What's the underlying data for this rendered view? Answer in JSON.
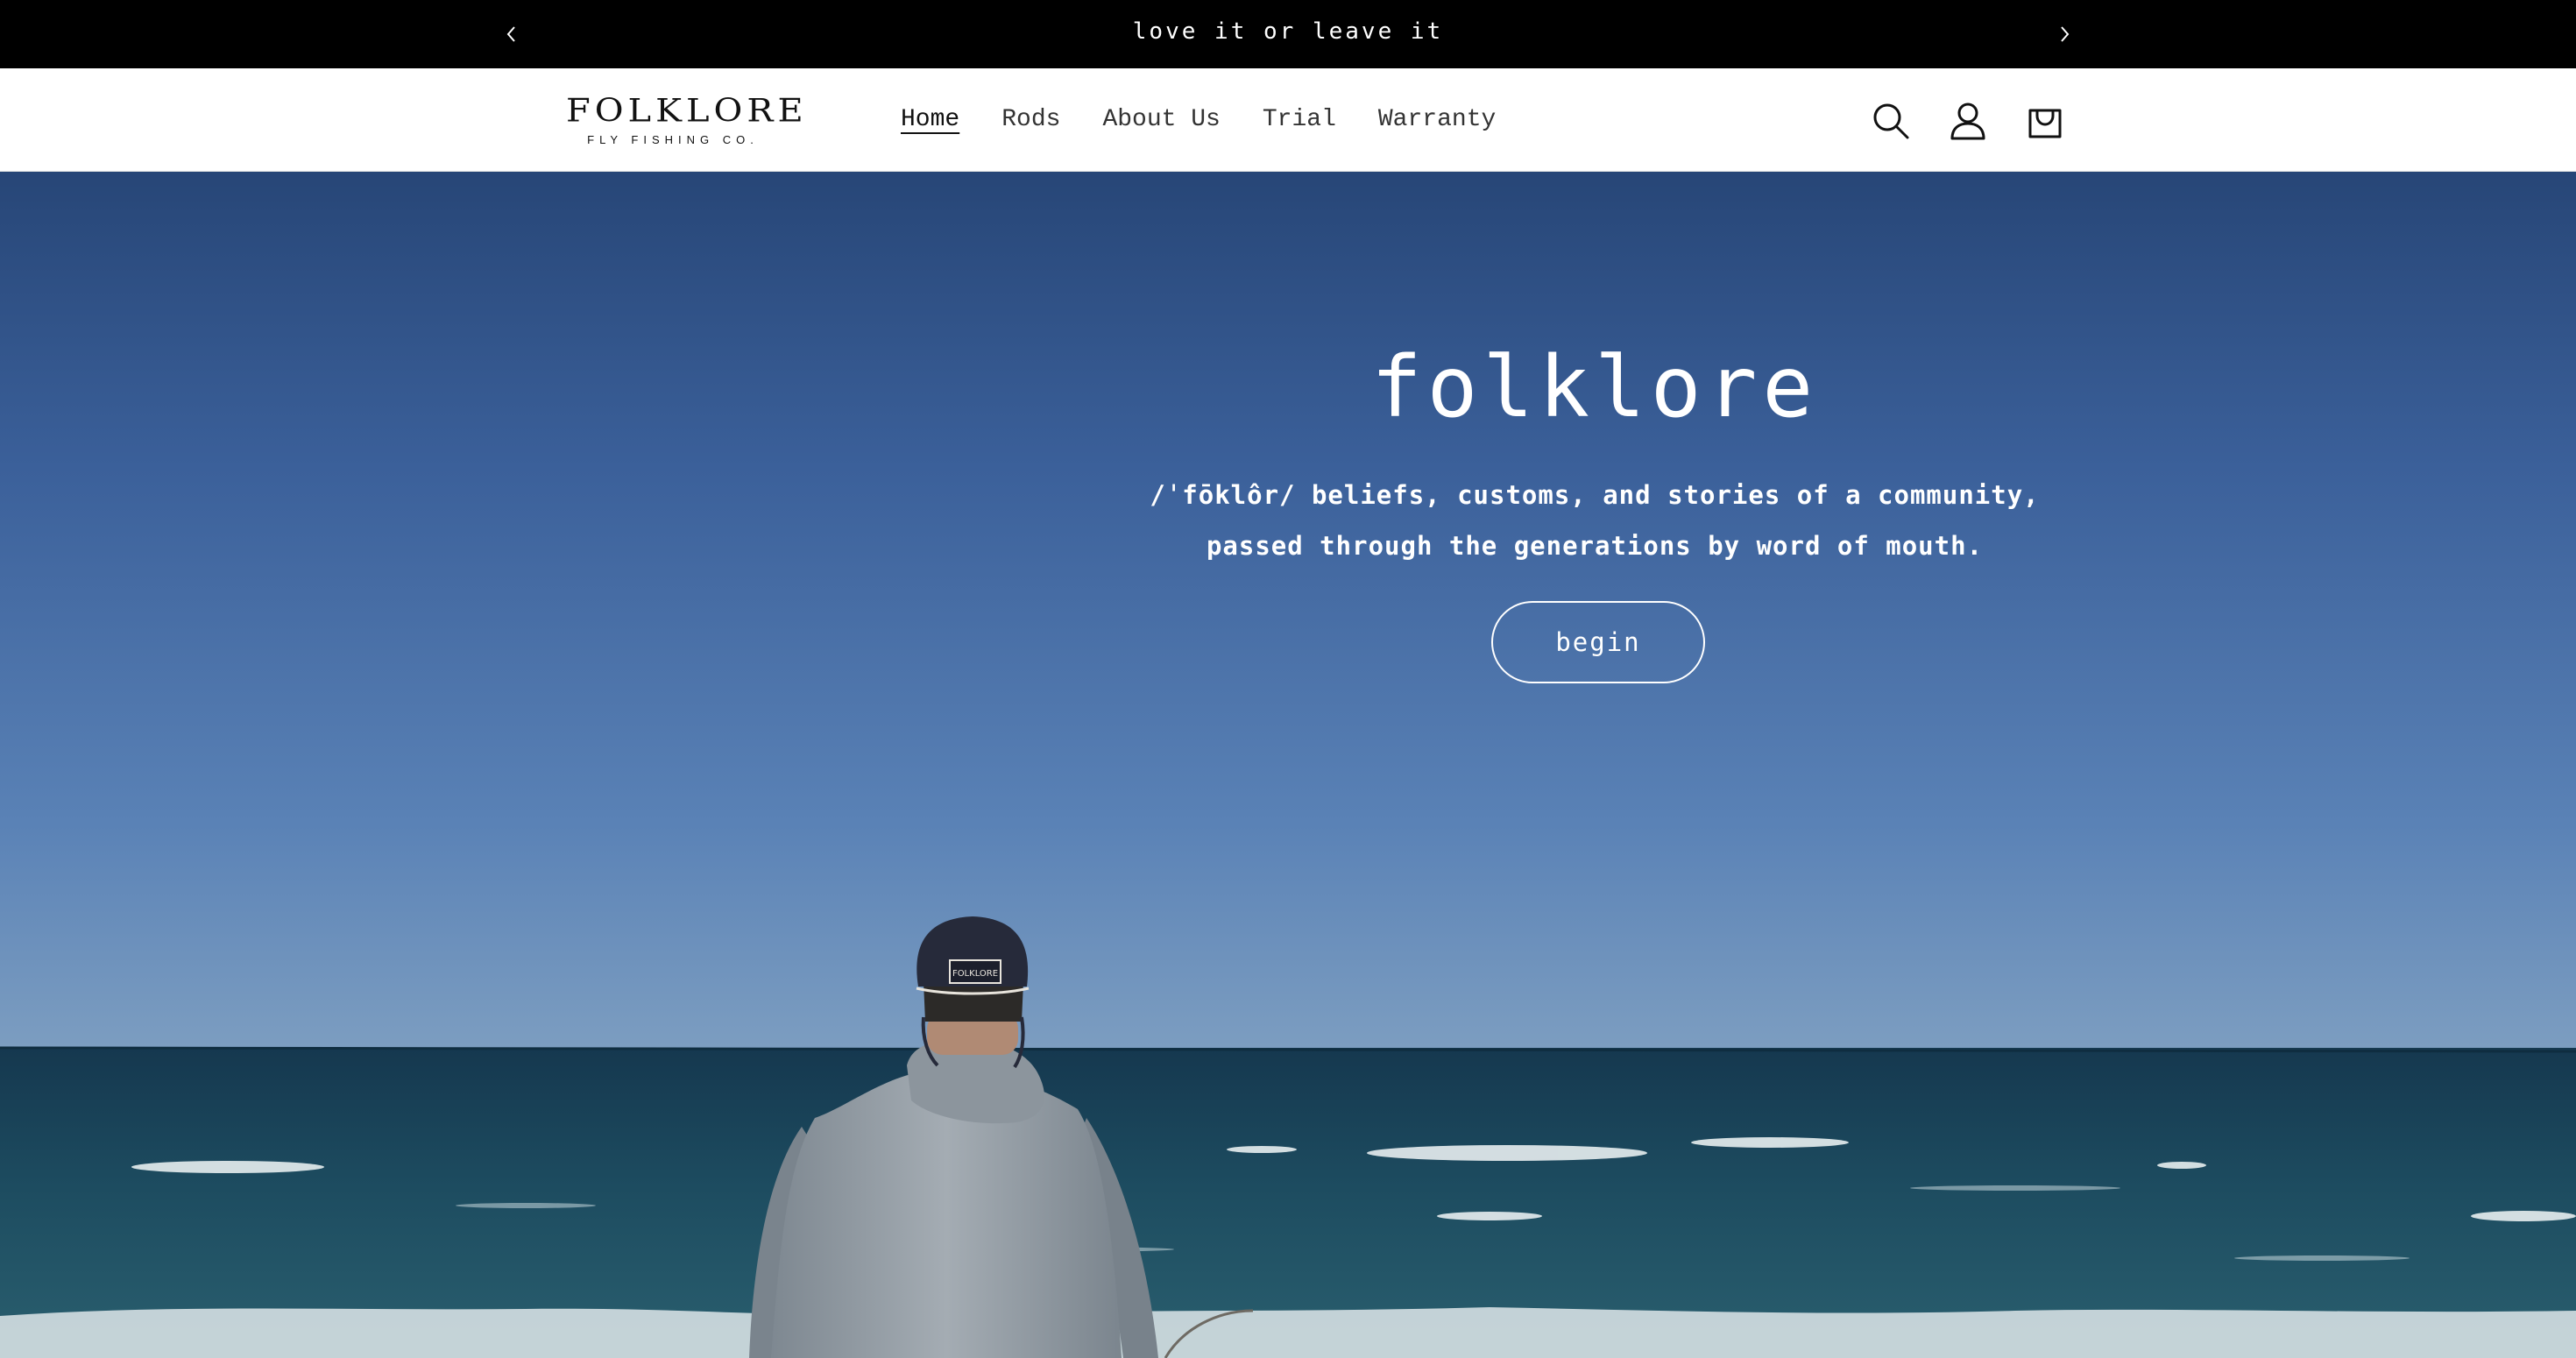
{
  "announcement": {
    "message": "love it or leave it",
    "prev_icon": "chevron-left-icon",
    "next_icon": "chevron-right-icon"
  },
  "header": {
    "logo": {
      "wordmark": "FOLKLORE",
      "tagline": "FLY FISHING CO."
    },
    "nav": [
      {
        "label": "Home",
        "active": true
      },
      {
        "label": "Rods",
        "active": false
      },
      {
        "label": "About Us",
        "active": false
      },
      {
        "label": "Trial",
        "active": false
      },
      {
        "label": "Warranty",
        "active": false
      }
    ],
    "icons": [
      "search-icon",
      "account-icon",
      "cart-icon"
    ]
  },
  "hero": {
    "title": "folklore",
    "subtitle_line1": "/ˈfōklôr/ beliefs, customs, and stories of a community,",
    "subtitle_line2": "passed through the generations by word of mouth.",
    "button_label": "begin",
    "cap_patch_text": "FOLKLORE"
  },
  "colors": {
    "announcement_bg": "#000000",
    "header_bg": "#ffffff",
    "sky_top": "#274677",
    "sky_horizon": "#9ab3c9",
    "sea": "#1f4a5c",
    "text_on_hero": "#ffffff"
  }
}
